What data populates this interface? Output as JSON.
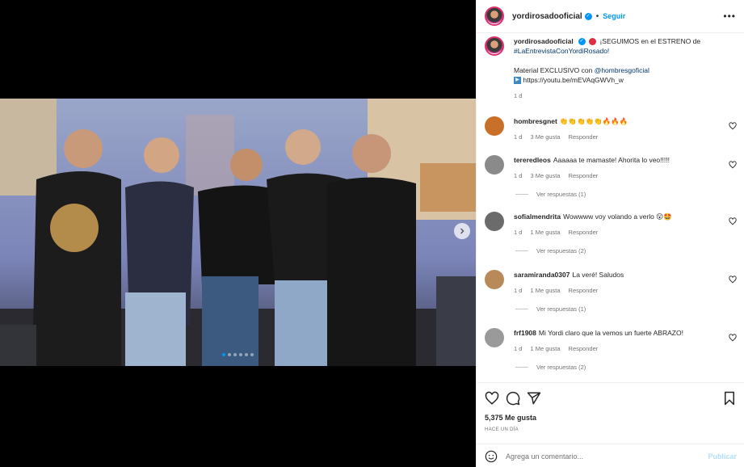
{
  "header": {
    "username": "yordirosadooficial",
    "separator": "•",
    "follow_label": "Seguir",
    "more_label": "•••"
  },
  "caption": {
    "username": "yordirosadooficial",
    "line1": "¡SEGUIMOS en el ESTRENO de",
    "hashtag": "#LaEntrevistaConYordiRosado!",
    "line2_prefix": "Material EXCLUSIVO con ",
    "mention": "@hombresgoficial",
    "url": "https://youtu.be/mEVAqGWVh_w",
    "time": "1 d"
  },
  "comments": [
    {
      "username": "hombresgnet",
      "text": "👏👏👏👏👏🔥🔥🔥",
      "time": "1 d",
      "likes": "3 Me gusta",
      "reply": "Responder",
      "replies": "",
      "avatar_color": "#c8702a"
    },
    {
      "username": "tereredleos",
      "text": "Aaaaaa te mamaste! Ahorita lo veo!!!!!",
      "time": "1 d",
      "likes": "3 Me gusta",
      "reply": "Responder",
      "replies": "Ver respuestas (1)",
      "avatar_color": "#8a8a8a"
    },
    {
      "username": "sofialmendrita",
      "text": "Wowwww voy volando a verlo 😮🤩",
      "time": "1 d",
      "likes": "1 Me gusta",
      "reply": "Responder",
      "replies": "Ver respuestas (2)",
      "avatar_color": "#6b6b6b"
    },
    {
      "username": "saramiranda0307",
      "text": "La veré! Saludos",
      "time": "1 d",
      "likes": "1 Me gusta",
      "reply": "Responder",
      "replies": "Ver respuestas (1)",
      "avatar_color": "#b88a5a"
    },
    {
      "username": "frf1908",
      "text": "Mi Yordi claro que la vemos un fuerte ABRAZO!",
      "time": "1 d",
      "likes": "1 Me gusta",
      "reply": "Responder",
      "replies": "Ver respuestas (2)",
      "avatar_color": "#9a9a9a"
    }
  ],
  "stats": {
    "likes": "5,375 Me gusta",
    "ago": "HACE UN DÍA"
  },
  "add_comment": {
    "placeholder": "Agrega un comentario...",
    "publish_label": "Publicar"
  },
  "carousel": {
    "dot_count": 6,
    "active_index": 0
  },
  "icon_names": [
    "heart-icon",
    "comment-icon",
    "share-icon",
    "bookmark-icon",
    "emoji-icon",
    "chevron-right-icon",
    "more-icon",
    "verified-icon"
  ],
  "colors": {
    "accent": "#0095f6",
    "text": "#262626",
    "secondary": "#737373",
    "link": "#00376b"
  }
}
